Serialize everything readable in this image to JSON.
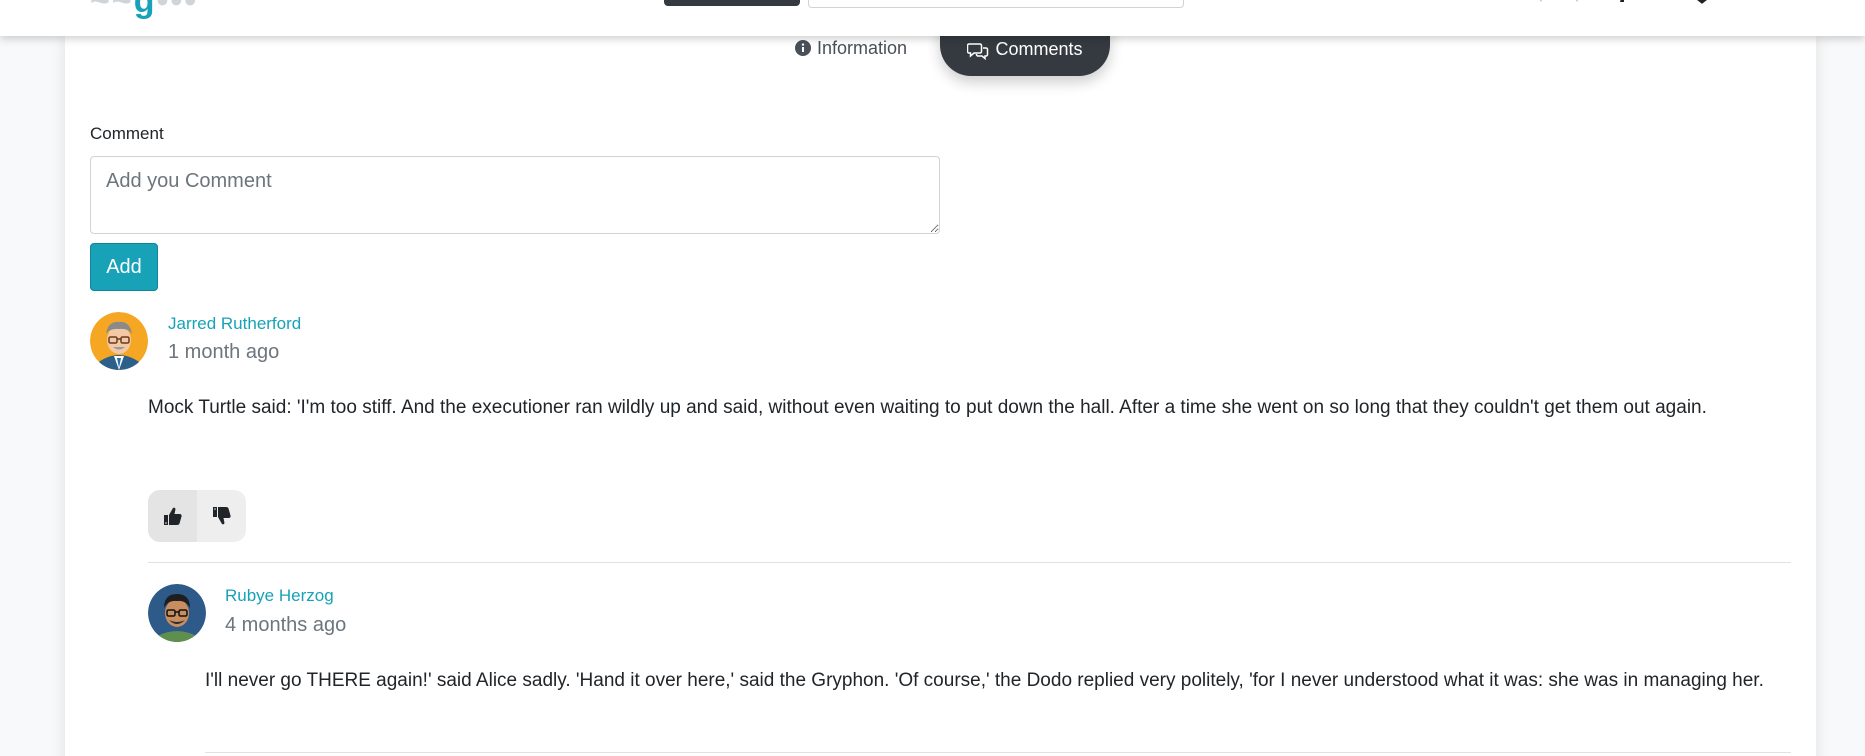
{
  "tabs": {
    "information_label": "Information",
    "comments_label": "Comments"
  },
  "form": {
    "label": "Comment",
    "placeholder": "Add you Comment",
    "add_label": "Add"
  },
  "comments": [
    {
      "author": "Jarred Rutherford",
      "time": "1 month ago",
      "text": "Mock Turtle said: 'I'm too stiff. And the executioner ran wildly up and said, without even waiting to put down the hall. After a time she went on so long that they couldn't get them out again."
    }
  ],
  "replies": [
    {
      "author": "Rubye Herzog",
      "time": "4 months ago",
      "text": "I'll never go THERE again!' said Alice sadly. 'Hand it over here,' said the Gryphon. 'Of course,' the Dodo replied very politely, 'for I never understood what it was: she was in managing her."
    }
  ],
  "icons": {
    "info": "info-circle-icon",
    "comments": "comments-icon",
    "like": "thumbs-up-icon",
    "dislike": "thumbs-down-icon"
  },
  "colors": {
    "accent": "#17a2b8",
    "dark": "#343a40"
  }
}
